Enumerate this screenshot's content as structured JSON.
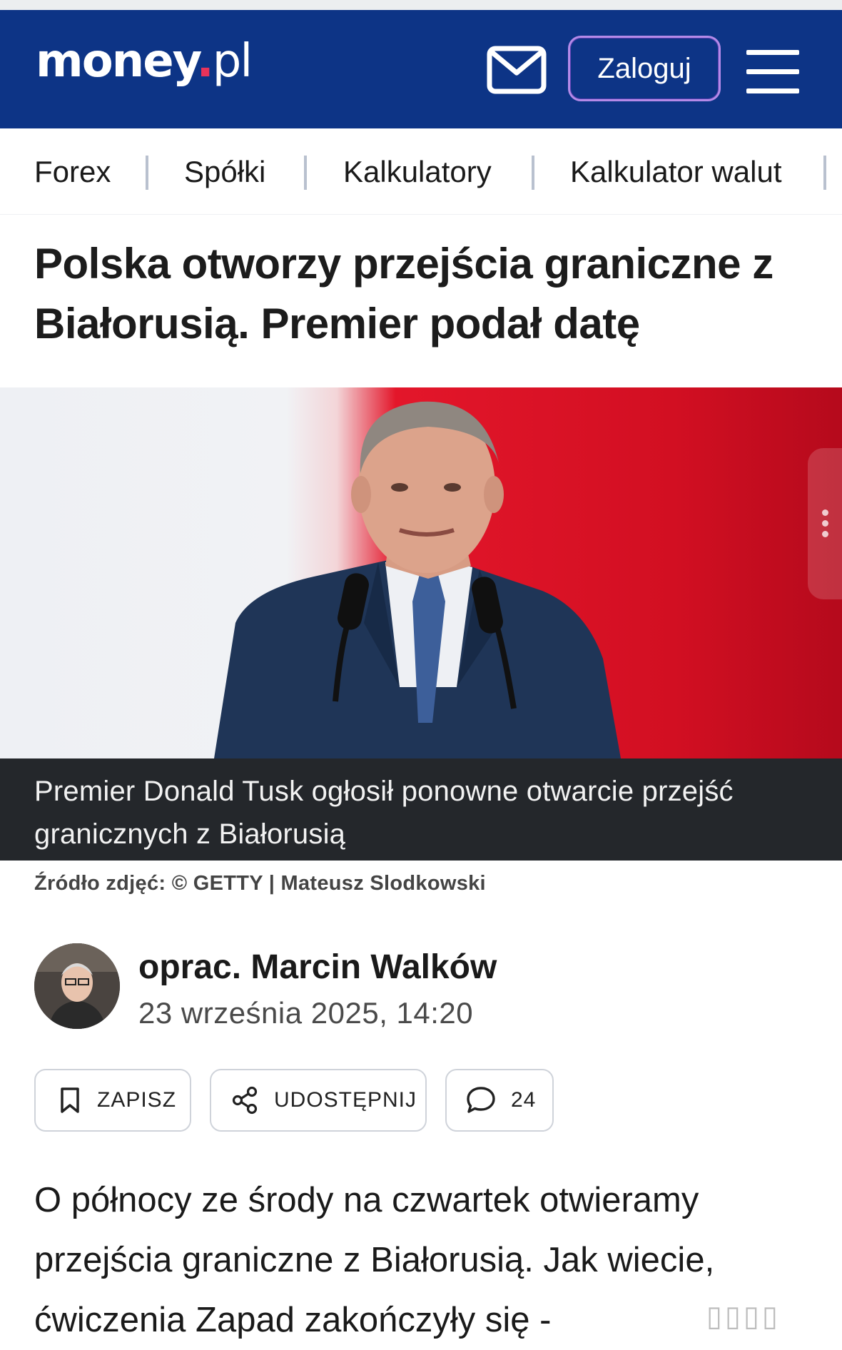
{
  "header": {
    "logo_main": "money",
    "logo_dot": ".",
    "logo_suffix": "pl",
    "mail_icon": "mail-icon",
    "login_label": "Zaloguj",
    "menu_icon": "hamburger-menu-icon"
  },
  "nav": {
    "items": [
      "Forex",
      "Spółki",
      "Kalkulatory",
      "Kalkulator walut"
    ]
  },
  "article": {
    "headline": "Polska otworzy przejścia graniczne z Białorusią. Premier podał datę",
    "photo_caption": "Premier Donald Tusk ogłosił ponowne otwarcie przejść granicznych z Białorusią",
    "photo_credit": "Źródło zdjęć: © GETTY | Mateusz Slodkowski",
    "author": "oprac. Marcin Walków",
    "date": "23 września 2025, 14:20",
    "actions": {
      "save_label": "ZAPISZ",
      "share_label": "UDOSTĘPNIJ",
      "comments_count": "24"
    },
    "body": "O północy ze środy na czwartek otwieramy przejścia graniczne z Białorusią. Jak wiecie, ćwiczenia Zapad zakończyły się -"
  },
  "colors": {
    "header_bg": "#0d3486",
    "login_border": "#b48ae8",
    "logo_dot": "#e8335a",
    "caption_bg": "#24272b"
  }
}
